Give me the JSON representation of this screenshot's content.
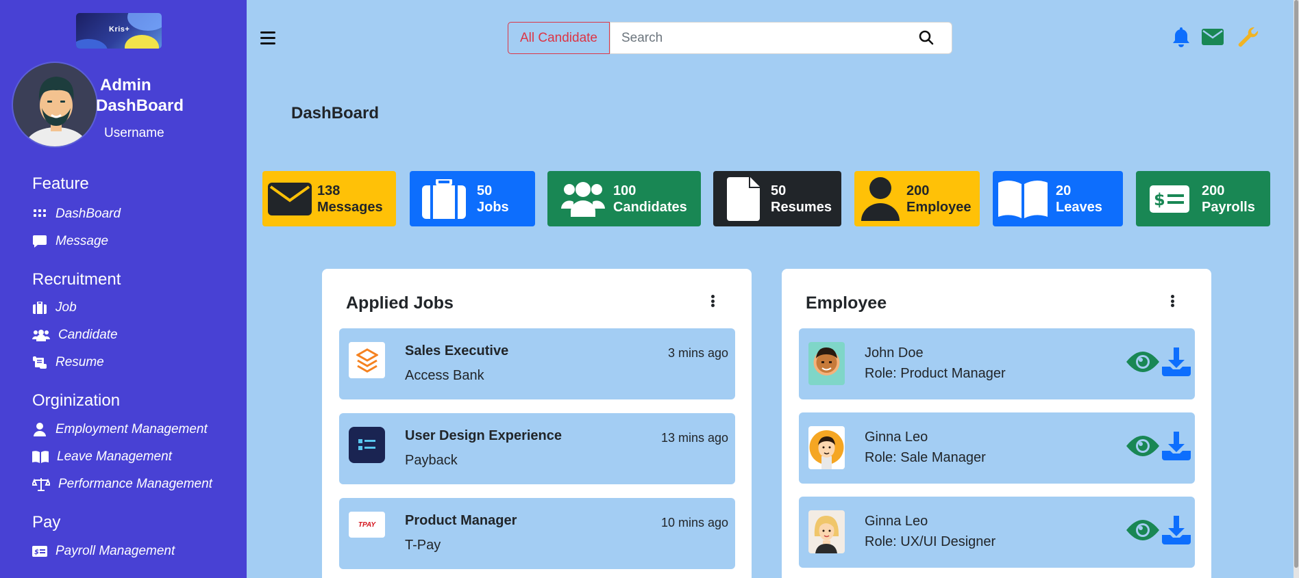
{
  "sidebar": {
    "logo_text": "Kris+",
    "admin_title_line1": "Admin",
    "admin_title_line2": "DashBoard",
    "username": "Username",
    "sections": [
      {
        "label": "Feature",
        "items": [
          {
            "label": "DashBoard",
            "icon": "grid-icon"
          },
          {
            "label": "Message",
            "icon": "chat-icon"
          }
        ]
      },
      {
        "label": "Recruitment",
        "items": [
          {
            "label": "Job",
            "icon": "briefcase-icon"
          },
          {
            "label": "Candidate",
            "icon": "users-icon"
          },
          {
            "label": "Resume",
            "icon": "scroll-icon"
          }
        ]
      },
      {
        "label": "Orginization",
        "items": [
          {
            "label": "Employment Management",
            "icon": "user-icon"
          },
          {
            "label": "Leave Management",
            "icon": "book-icon"
          },
          {
            "label": "Performance Management",
            "icon": "scale-icon"
          }
        ]
      },
      {
        "label": "Pay",
        "items": [
          {
            "label": "Payroll Management",
            "icon": "money-check-icon"
          }
        ]
      }
    ]
  },
  "topbar": {
    "candidate_button": "All Candidate",
    "search_placeholder": "Search",
    "icons": [
      "bell-icon",
      "envelope-icon",
      "wrench-icon"
    ]
  },
  "page_title": "DashBoard",
  "stats": [
    {
      "count": "138",
      "label": "Messages",
      "icon": "envelope-icon",
      "bg": "#ffc107",
      "fg": "#212529"
    },
    {
      "count": "50",
      "label": "Jobs",
      "icon": "briefcase-icon",
      "bg": "#0d6efd",
      "fg": "#ffffff"
    },
    {
      "count": "100",
      "label": "Candidates",
      "icon": "users-icon",
      "bg": "#198754",
      "fg": "#ffffff"
    },
    {
      "count": "50",
      "label": "Resumes",
      "icon": "file-icon",
      "bg": "#212529",
      "fg": "#ffffff"
    },
    {
      "count": "200",
      "label": "Employee",
      "icon": "user-icon",
      "bg": "#ffc107",
      "fg": "#212529"
    },
    {
      "count": "20",
      "label": "Leaves",
      "icon": "book-icon",
      "bg": "#0d6efd",
      "fg": "#ffffff"
    },
    {
      "count": "200",
      "label": "Payrolls",
      "icon": "money-check-icon",
      "bg": "#198754",
      "fg": "#ffffff"
    }
  ],
  "applied_jobs": {
    "title": "Applied Jobs",
    "items": [
      {
        "title": "Sales Executive",
        "company": "Access Bank",
        "time": "3 mins ago",
        "logo": "access-bank-logo"
      },
      {
        "title": "User Design Experience",
        "company": "Payback",
        "time": "13 mins ago",
        "logo": "payback-logo"
      },
      {
        "title": "Product Manager",
        "company": "T-Pay",
        "time": "10 mins ago",
        "logo": "tpay-logo",
        "logo_text": "TPAY"
      }
    ]
  },
  "employee": {
    "title": "Employee",
    "items": [
      {
        "name": "John Doe",
        "role": "Role: Product Manager"
      },
      {
        "name": "Ginna Leo",
        "role": "Role: Sale Manager"
      },
      {
        "name": "Ginna Leo",
        "role": "Role: UX/UI Designer"
      }
    ]
  },
  "colors": {
    "sidebar": "#4841d4",
    "page_bg": "#a3cdf3",
    "view_icon": "#198754",
    "download_icon": "#0d6efd",
    "danger": "#dc3545"
  }
}
